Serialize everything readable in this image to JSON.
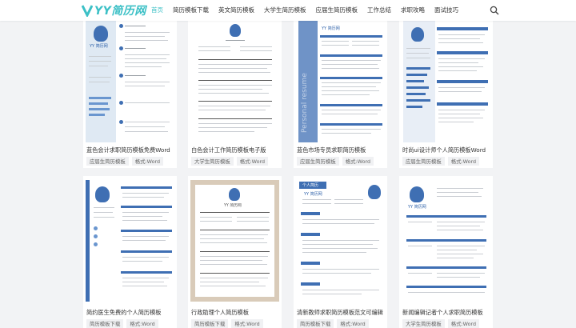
{
  "brand": {
    "logo_text": "YY简历网",
    "accent": "#3cc0c6"
  },
  "nav": {
    "items": [
      "首页",
      "简历模板下载",
      "英文简历模板",
      "大学生简历模板",
      "应届生简历模板",
      "工作总结",
      "求职攻略",
      "面试技巧"
    ],
    "active_index": 0
  },
  "cards": [
    {
      "title": "蓝色会计求职简历模板免费Word",
      "tags": [
        "应届生简历模板",
        "格式:Word"
      ]
    },
    {
      "title": "白色会计工作简历模板电子版",
      "tags": [
        "大学生简历模板",
        "格式:Word"
      ]
    },
    {
      "title": "蓝色市场专员求职简历模板",
      "tags": [
        "应届生简历模板",
        "格式:Word"
      ]
    },
    {
      "title": "时尚ui设计师个人简历模板Word",
      "tags": [
        "应届生简历模板",
        "格式:Word"
      ]
    },
    {
      "title": "简约医生免费的个人简历模板",
      "tags": [
        "简历模板下载",
        "格式:Word"
      ]
    },
    {
      "title": "行政助理个人简历模板",
      "tags": [
        "简历模板下载",
        "格式:Word"
      ]
    },
    {
      "title": "清新教师求职简历模板范文可编辑",
      "tags": [
        "简历模板下载",
        "格式:Word"
      ]
    },
    {
      "title": "新闻编辑记者个人求职简历模板",
      "tags": [
        "大学生简历模板",
        "格式:Word"
      ]
    }
  ],
  "thumb_texts": {
    "name": "YY 简历网",
    "badge": "个人简历",
    "vertical": "Personal resume"
  }
}
